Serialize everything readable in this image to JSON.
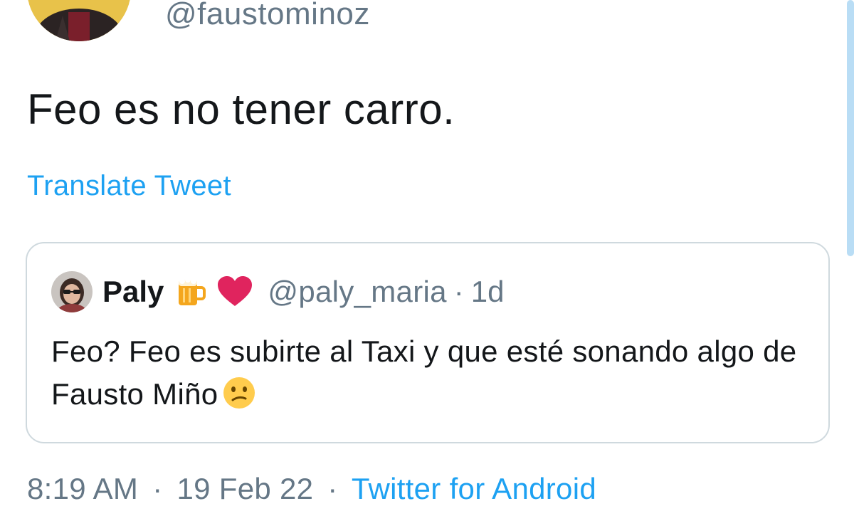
{
  "tweet": {
    "handle": "@faustominoz",
    "text": "Feo es no tener carro.",
    "translate_label": "Translate Tweet",
    "time": "8:19 AM",
    "separator": "·",
    "date": "19 Feb 22",
    "source": "Twitter for Android"
  },
  "quoted_tweet": {
    "name": "Paly",
    "name_emojis": [
      "beer-mug-emoji",
      "red-heart-emoji"
    ],
    "handle": "@paly_maria",
    "separator": "·",
    "time_ago": "1d",
    "text": "Feo? Feo es subirte al Taxi y que esté sonando algo de Fausto Miño",
    "trailing_emoji": "confused-face-emoji"
  },
  "colors": {
    "text": "#14171a",
    "secondary": "#657786",
    "link": "#1da1f2",
    "border": "#cfd9de",
    "scrollbar": "#b9ddf5"
  }
}
